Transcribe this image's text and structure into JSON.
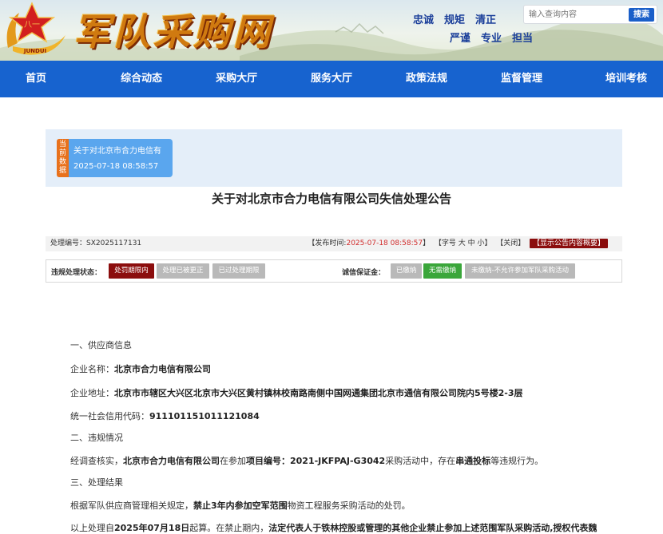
{
  "header": {
    "site_title_chars": [
      "军",
      "队",
      "采",
      "购",
      "网"
    ],
    "emblem_text": "JUNDUI",
    "slogan_row1": [
      "忠诚",
      "规矩",
      "清正"
    ],
    "slogan_row2": [
      "严谨",
      "专业",
      "担当"
    ],
    "search_placeholder": "输入查询内容",
    "search_button": "搜索"
  },
  "nav": {
    "items": [
      "首页",
      "综合动态",
      "采购大厅",
      "服务大厅",
      "政策法规",
      "监督管理",
      "培训考核"
    ]
  },
  "banner": {
    "tag": "当前数据",
    "title": "关于对北京市合力电信有",
    "date": "2025-07-18 08:58:57"
  },
  "notice": {
    "title": "关于对北京市合力电信有限公司失信处理公告",
    "number_label": "处理编号：",
    "number": "SX2025117131",
    "publish_label": "【发布时间:",
    "publish_time": "2025-07-18 08:58:57",
    "publish_close": "】",
    "font_label": "【字号",
    "font_big": "大",
    "font_mid": "中",
    "font_small": "小】",
    "close_label": "【关闭】",
    "summary_button": "【显示公告内容概要】"
  },
  "status": {
    "violation_label": "违规处理状态：",
    "violation_states": [
      "处罚期限内",
      "处理已被更正",
      "已过处理期限"
    ],
    "deposit_label": "诚信保证金：",
    "deposit_states": [
      "已缴纳",
      "无需缴纳",
      "未缴纳-不允许参加军队采购活动"
    ]
  },
  "colors": {
    "nav_blue": "#1763cf",
    "active_red": "#8b0d0d",
    "active_green": "#3aa63a",
    "inactive_gray": "#b9b9b9",
    "banner_tag": "#e8711c",
    "banner_card": "#5aa6ee"
  },
  "content": {
    "s1_heading": "一、供应商信息",
    "company_label": "企业名称：",
    "company_name": "北京市合力电信有限公司",
    "address_label": "企业地址：",
    "address": "北京市市辖区大兴区北京市大兴区黄村镇林校南路南侧中国网通集团北京市通信有限公司院内5号楼2-3层",
    "credit_label": "统一社会信用代码：",
    "credit_code": "911101151011121084",
    "s2_heading": "二、违规情况",
    "v_pre": "经调查核实，",
    "v_company": "北京市合力电信有限公司",
    "v_mid1": "在参加",
    "v_proj_label": "项目编号：",
    "v_proj": "2021-JKFPAJ-G3042",
    "v_mid2": "采购活动中，存在",
    "v_type": "串通投标",
    "v_end": "等违规行为。",
    "s3_heading": "三、处理结果",
    "r_pre": "根据军队供应商管理相关规定，",
    "r_bold": "禁止3年内参加空军范围",
    "r_end": "物资工程服务采购活动的处罚。",
    "l_pre": "以上处理自",
    "l_date": "2025年07月18日",
    "l_mid": "起算。在禁止期内，",
    "l_bold": "法定代表人于铁林控股或管理的其他企业禁止参加上述范围军队采购活动,授权代表魏"
  }
}
